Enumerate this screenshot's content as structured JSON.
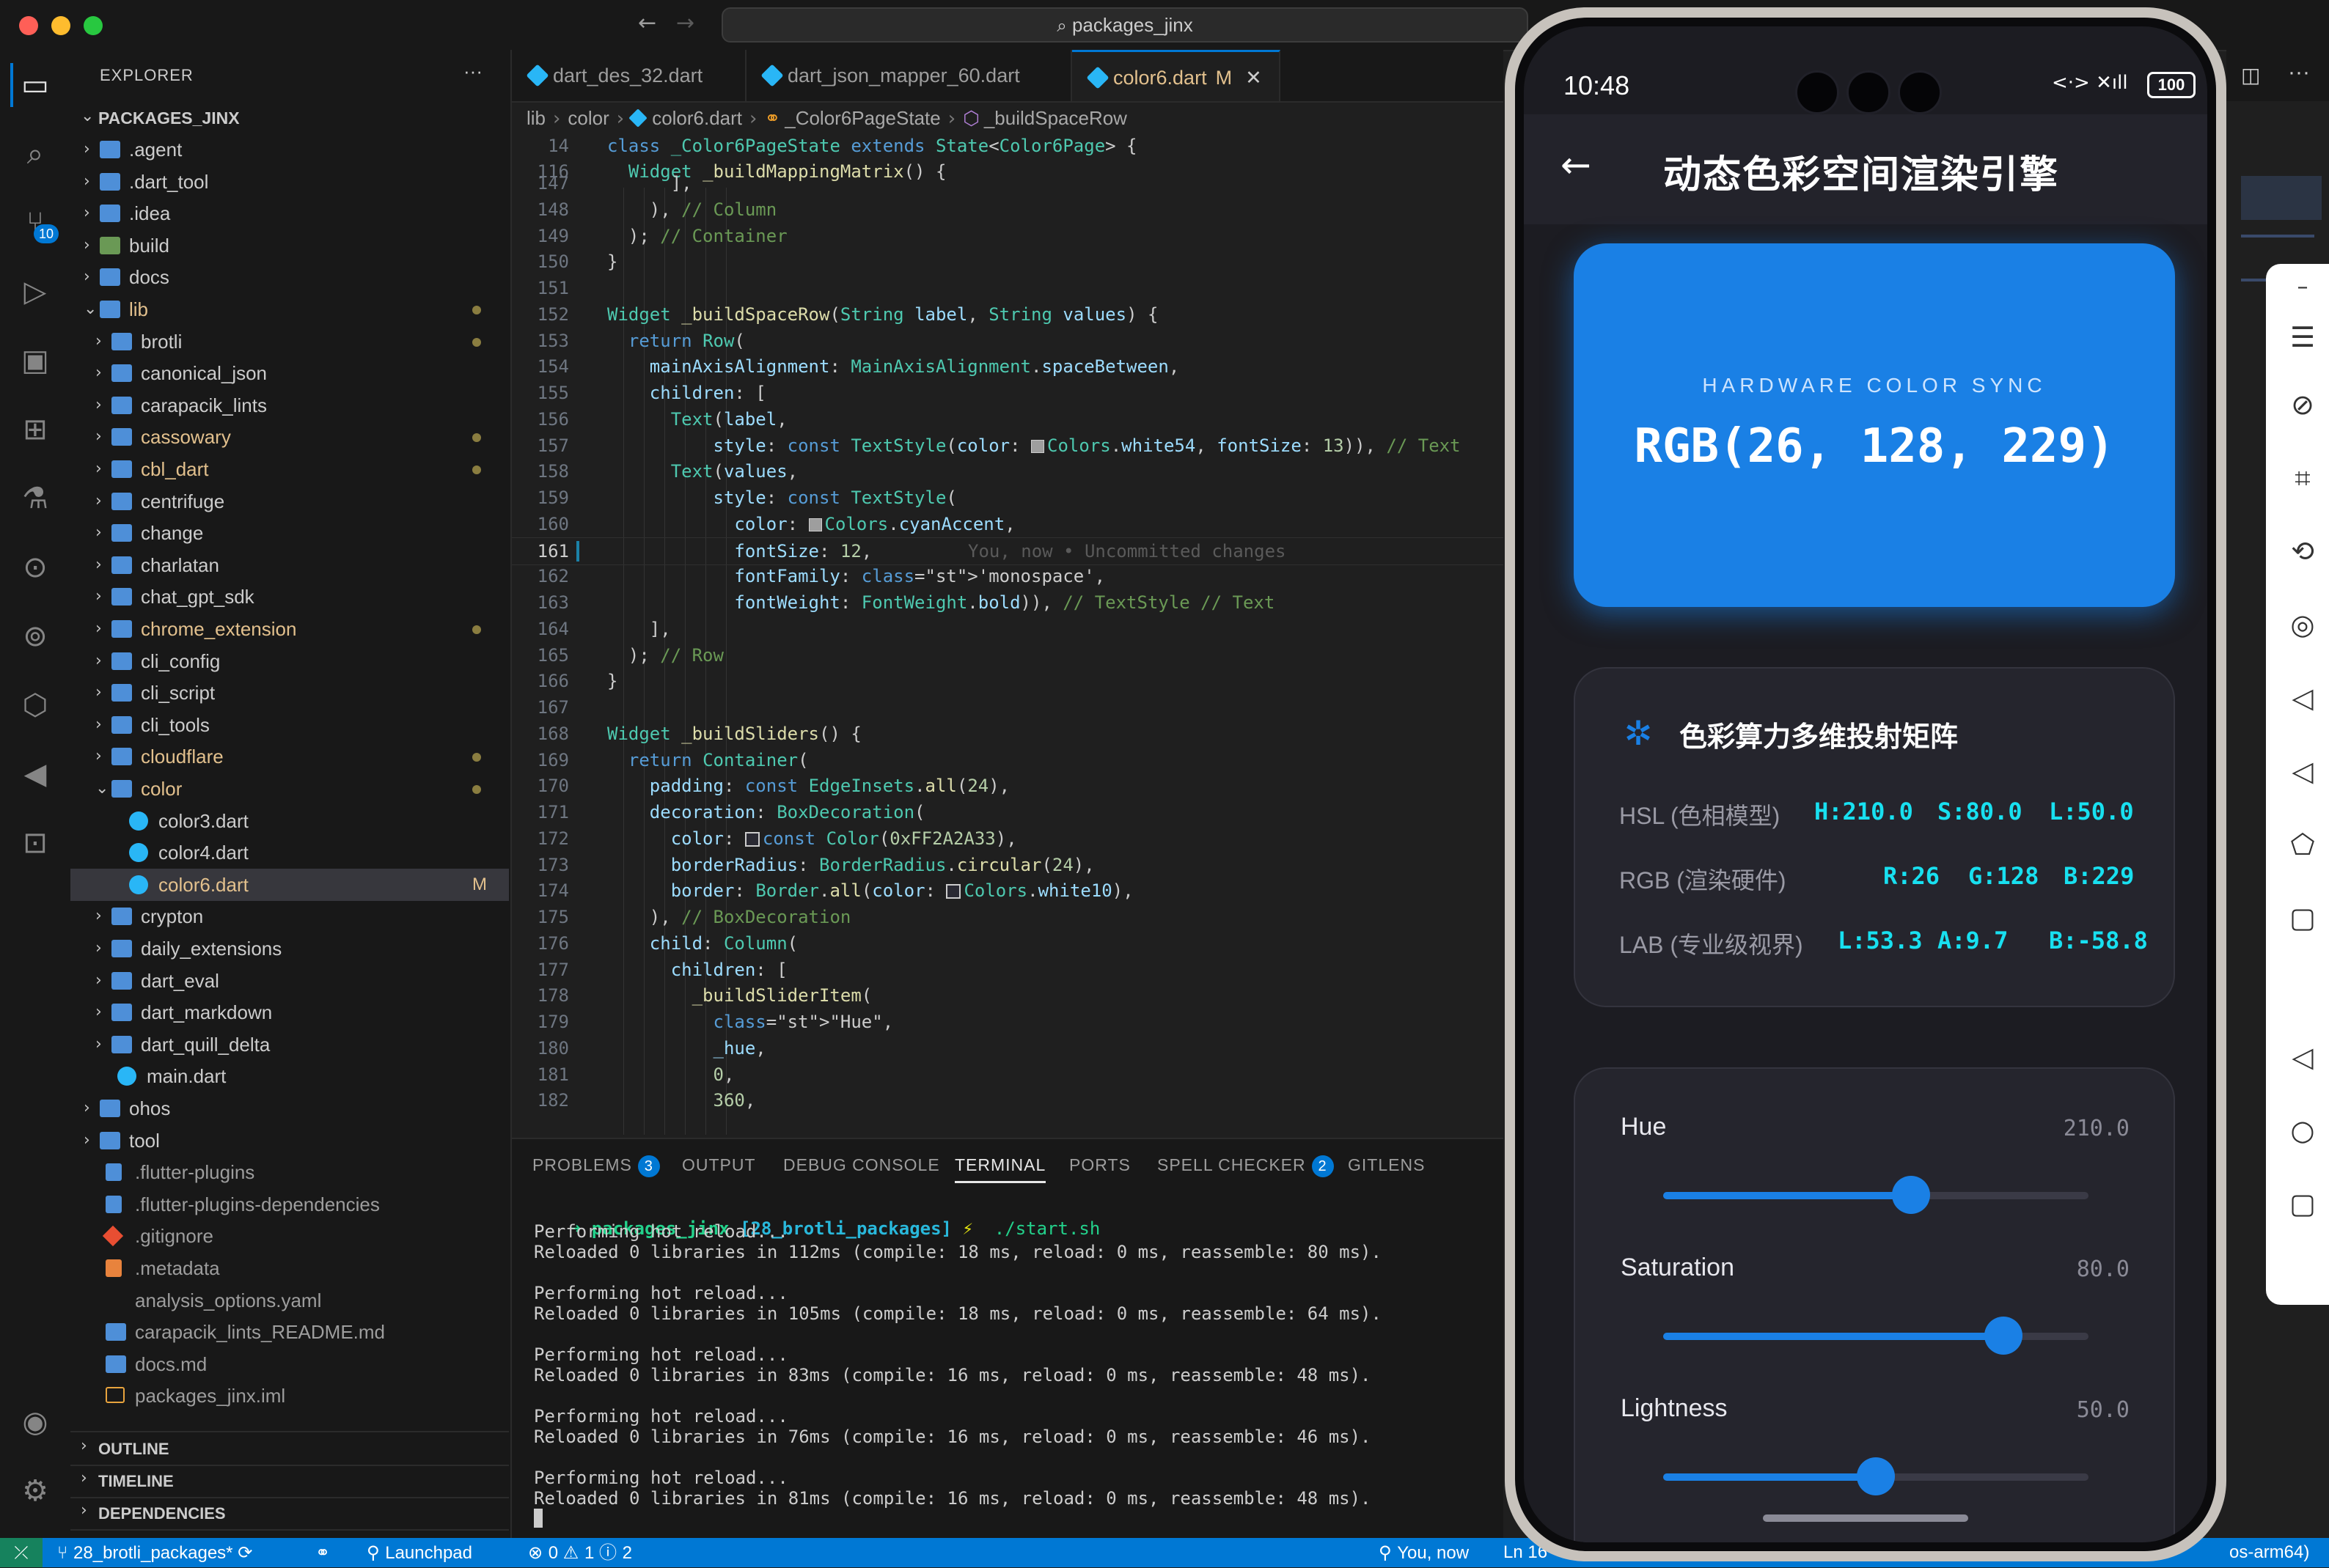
{
  "window": {
    "search_title": "packages_jinx"
  },
  "sidebar": {
    "header": "EXPLORER",
    "more": "···",
    "root": "PACKAGES_JINX",
    "items": [
      {
        "label": ".agent",
        "kind": "folder",
        "depth": 0,
        "open": false,
        "mod": ""
      },
      {
        "label": ".dart_tool",
        "kind": "folder",
        "depth": 0,
        "open": false,
        "mod": ""
      },
      {
        "label": ".idea",
        "kind": "folder",
        "depth": 0,
        "open": false,
        "mod": ""
      },
      {
        "label": "build",
        "kind": "folder-green",
        "depth": 0,
        "open": false,
        "mod": ""
      },
      {
        "label": "docs",
        "kind": "folder",
        "depth": 0,
        "open": false,
        "mod": ""
      },
      {
        "label": "lib",
        "kind": "folder",
        "depth": 0,
        "open": true,
        "mod": "dot"
      },
      {
        "label": "brotli",
        "kind": "folder",
        "depth": 1,
        "open": false,
        "mod": "dot"
      },
      {
        "label": "canonical_json",
        "kind": "folder",
        "depth": 1,
        "open": false,
        "mod": ""
      },
      {
        "label": "carapacik_lints",
        "kind": "folder",
        "depth": 1,
        "open": false,
        "mod": ""
      },
      {
        "label": "cassowary",
        "kind": "folder",
        "depth": 1,
        "open": false,
        "mod": "dot"
      },
      {
        "label": "cbl_dart",
        "kind": "folder",
        "depth": 1,
        "open": false,
        "mod": "dot"
      },
      {
        "label": "centrifuge",
        "kind": "folder",
        "depth": 1,
        "open": false,
        "mod": ""
      },
      {
        "label": "change",
        "kind": "folder",
        "depth": 1,
        "open": false,
        "mod": ""
      },
      {
        "label": "charlatan",
        "kind": "folder",
        "depth": 1,
        "open": false,
        "mod": ""
      },
      {
        "label": "chat_gpt_sdk",
        "kind": "folder",
        "depth": 1,
        "open": false,
        "mod": ""
      },
      {
        "label": "chrome_extension",
        "kind": "folder",
        "depth": 1,
        "open": false,
        "mod": "dot"
      },
      {
        "label": "cli_config",
        "kind": "folder",
        "depth": 1,
        "open": false,
        "mod": ""
      },
      {
        "label": "cli_script",
        "kind": "folder",
        "depth": 1,
        "open": false,
        "mod": ""
      },
      {
        "label": "cli_tools",
        "kind": "folder",
        "depth": 1,
        "open": false,
        "mod": ""
      },
      {
        "label": "cloudflare",
        "kind": "folder",
        "depth": 1,
        "open": false,
        "mod": "dot"
      },
      {
        "label": "color",
        "kind": "folder",
        "depth": 1,
        "open": true,
        "mod": "dot"
      },
      {
        "label": "color3.dart",
        "kind": "dart",
        "depth": 2,
        "open": null,
        "mod": ""
      },
      {
        "label": "color4.dart",
        "kind": "dart",
        "depth": 2,
        "open": null,
        "mod": ""
      },
      {
        "label": "color6.dart",
        "kind": "dart",
        "depth": 2,
        "open": null,
        "mod": "M"
      },
      {
        "label": "crypton",
        "kind": "folder",
        "depth": 1,
        "open": false,
        "mod": ""
      },
      {
        "label": "daily_extensions",
        "kind": "folder",
        "depth": 1,
        "open": false,
        "mod": ""
      },
      {
        "label": "dart_eval",
        "kind": "folder",
        "depth": 1,
        "open": false,
        "mod": ""
      },
      {
        "label": "dart_markdown",
        "kind": "folder",
        "depth": 1,
        "open": false,
        "mod": ""
      },
      {
        "label": "dart_quill_delta",
        "kind": "folder",
        "depth": 1,
        "open": false,
        "mod": ""
      },
      {
        "label": "main.dart",
        "kind": "dart",
        "depth": 1,
        "open": null,
        "mod": ""
      },
      {
        "label": "ohos",
        "kind": "folder",
        "depth": 0,
        "open": false,
        "mod": ""
      },
      {
        "label": "tool",
        "kind": "folder",
        "depth": 0,
        "open": false,
        "mod": ""
      },
      {
        "label": ".flutter-plugins",
        "kind": "file",
        "depth": 0,
        "open": null,
        "mod": ""
      },
      {
        "label": ".flutter-plugins-dependencies",
        "kind": "file",
        "depth": 0,
        "open": null,
        "mod": ""
      },
      {
        "label": ".gitignore",
        "kind": "git",
        "depth": 0,
        "open": null,
        "mod": ""
      },
      {
        "label": ".metadata",
        "kind": "meta",
        "depth": 0,
        "open": null,
        "mod": ""
      },
      {
        "label": "analysis_options.yaml",
        "kind": "yaml",
        "depth": 0,
        "open": null,
        "mod": ""
      },
      {
        "label": "carapacik_lints_README.md",
        "kind": "md",
        "depth": 0,
        "open": null,
        "mod": ""
      },
      {
        "label": "docs.md",
        "kind": "md",
        "depth": 0,
        "open": null,
        "mod": ""
      },
      {
        "label": "packages_jinx.iml",
        "kind": "xml",
        "depth": 0,
        "open": null,
        "mod": ""
      }
    ],
    "sections": [
      "OUTLINE",
      "TIMELINE",
      "DEPENDENCIES"
    ]
  },
  "activity": {
    "scm_badge": "10"
  },
  "tabs": [
    {
      "label": "dart_des_32.dart",
      "active": false,
      "flag": ""
    },
    {
      "label": "dart_json_mapper_60.dart",
      "active": false,
      "flag": ""
    },
    {
      "label": "color6.dart",
      "active": true,
      "flag": "M"
    }
  ],
  "breadcrumb": [
    "lib",
    "color",
    "color6.dart",
    "_Color6PageState",
    "_buildSpaceRow"
  ],
  "sticky": [
    {
      "n": "14",
      "t": "class _Color6PageState extends State<Color6Page> {"
    },
    {
      "n": "116",
      "t": "  Widget _buildMappingMatrix() {"
    }
  ],
  "code": [
    {
      "n": "147",
      "t": "      ],"
    },
    {
      "n": "148",
      "t": "    ), // Column"
    },
    {
      "n": "149",
      "t": "  ); // Container"
    },
    {
      "n": "150",
      "t": "}"
    },
    {
      "n": "151",
      "t": ""
    },
    {
      "n": "152",
      "t": "Widget _buildSpaceRow(String label, String values) {"
    },
    {
      "n": "153",
      "t": "  return Row("
    },
    {
      "n": "154",
      "t": "    mainAxisAlignment: MainAxisAlignment.spaceBetween,"
    },
    {
      "n": "155",
      "t": "    children: ["
    },
    {
      "n": "156",
      "t": "      Text(label,"
    },
    {
      "n": "157",
      "t": "          style: const TextStyle(color: ■Colors.white54, fontSize: 13)), // Text"
    },
    {
      "n": "158",
      "t": "      Text(values,"
    },
    {
      "n": "159",
      "t": "          style: const TextStyle("
    },
    {
      "n": "160",
      "t": "            color: ■Colors.cyanAccent,"
    },
    {
      "n": "161",
      "t": "            fontSize: 12,"
    },
    {
      "n": "162",
      "t": "            fontFamily: 'monospace',"
    },
    {
      "n": "163",
      "t": "            fontWeight: FontWeight.bold)), // TextStyle // Text"
    },
    {
      "n": "164",
      "t": "    ],"
    },
    {
      "n": "165",
      "t": "  ); // Row"
    },
    {
      "n": "166",
      "t": "}"
    },
    {
      "n": "167",
      "t": ""
    },
    {
      "n": "168",
      "t": "Widget _buildSliders() {"
    },
    {
      "n": "169",
      "t": "  return Container("
    },
    {
      "n": "170",
      "t": "    padding: const EdgeInsets.all(24),"
    },
    {
      "n": "171",
      "t": "    decoration: BoxDecoration("
    },
    {
      "n": "172",
      "t": "      color: □const Color(0xFF2A2A33),"
    },
    {
      "n": "173",
      "t": "      borderRadius: BorderRadius.circular(24),"
    },
    {
      "n": "174",
      "t": "      border: Border.all(color: □Colors.white10),"
    },
    {
      "n": "175",
      "t": "    ), // BoxDecoration"
    },
    {
      "n": "176",
      "t": "    child: Column("
    },
    {
      "n": "177",
      "t": "      children: ["
    },
    {
      "n": "178",
      "t": "        _buildSliderItem("
    },
    {
      "n": "179",
      "t": "          \"Hue\","
    },
    {
      "n": "180",
      "t": "          _hue,"
    },
    {
      "n": "181",
      "t": "          0,"
    },
    {
      "n": "182",
      "t": "          360,"
    }
  ],
  "blame": "You, now • Uncommitted changes",
  "panel": {
    "tabs": [
      "PROBLEMS",
      "OUTPUT",
      "DEBUG CONSOLE",
      "TERMINAL",
      "PORTS",
      "SPELL CHECKER",
      "GITLENS"
    ],
    "problems_count": "3",
    "spell_count": "2",
    "active": "TERMINAL"
  },
  "terminal": {
    "prompt_dir": "packages_jinx",
    "prompt_branch": "[28_brotli_packages]",
    "prompt_sym": "⚡",
    "command": "./start.sh",
    "lines": [
      "Performing hot reload...",
      "Reloaded 0 libraries in 112ms (compile: 18 ms, reload: 0 ms, reassemble: 80 ms).",
      "",
      "Performing hot reload...",
      "Reloaded 0 libraries in 105ms (compile: 18 ms, reload: 0 ms, reassemble: 64 ms).",
      "",
      "Performing hot reload...",
      "Reloaded 0 libraries in 83ms (compile: 16 ms, reload: 0 ms, reassemble: 48 ms).",
      "",
      "Performing hot reload...",
      "Reloaded 0 libraries in 76ms (compile: 16 ms, reload: 0 ms, reassemble: 46 ms).",
      "",
      "Performing hot reload...",
      "Reloaded 0 libraries in 81ms (compile: 16 ms, reload: 0 ms, reassemble: 48 ms)."
    ]
  },
  "status": {
    "branch": "28_brotli_packages*",
    "launchpad": "Launchpad",
    "errors": "0",
    "warnings": "1",
    "infos": "2",
    "blame": "You, now",
    "ln": "Ln 16",
    "arch": "os-arm64)"
  },
  "phone": {
    "time": "10:48",
    "battery": "100",
    "title": "动态色彩空间渲染引擎",
    "hero": {
      "caption": "HARDWARE COLOR SYNC",
      "value": "RGB(26, 128, 229)",
      "color": "#1a80e5"
    },
    "matrix": {
      "title": "色彩算力多维投射矩阵",
      "rows": [
        {
          "label": "HSL (色相模型)",
          "vals": [
            "H:210.0",
            "S:80.0",
            "L:50.0"
          ]
        },
        {
          "label": "RGB (渲染硬件)",
          "vals": [
            "R:26",
            "G:128",
            "B:229"
          ]
        },
        {
          "label": "LAB (专业级视界)",
          "vals": [
            "L:53.3",
            "A:9.7",
            "B:-58.8"
          ]
        }
      ]
    },
    "sliders": [
      {
        "name": "Hue",
        "value": "210.0",
        "fraction": 0.583
      },
      {
        "name": "Saturation",
        "value": "80.0",
        "fraction": 0.8
      },
      {
        "name": "Lightness",
        "value": "50.0",
        "fraction": 0.5
      }
    ]
  }
}
